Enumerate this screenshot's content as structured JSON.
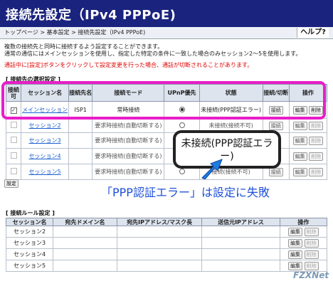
{
  "header": {
    "title": "接続先設定（IPv4 PPPoE)",
    "breadcrumb": "トップページ > 基本設定 > 接続先設定（IPv4 PPPoE)",
    "help": "ヘルプ?"
  },
  "description": {
    "line1": "複数の接続先と同時に接続するよう設定することができます。",
    "line2": "通常の通信にはメインセッションを使用し、指定した特定の条件に一致した場合のみセッション2〜5を使用します。",
    "warning": "通話中に[設定]ボタンをクリックして設定変更を行った場合、通話が切断されることがあります。"
  },
  "session_table": {
    "section_title": "[ 接続先の選択設定 ]",
    "headers": [
      "接続可",
      "セッション名",
      "接続先名",
      "接続モード",
      "UPnP優先",
      "状態",
      "接続/切断",
      "操作"
    ],
    "rows": [
      {
        "checked": true,
        "name": "メインセッション",
        "dest": "ISP1",
        "mode": "常時接続",
        "upnp": true,
        "status": "未接続(PPP認証エラー)",
        "connect": "接続",
        "edit": "編集",
        "delete": "削除"
      },
      {
        "checked": false,
        "name": "セッション2",
        "dest": "",
        "mode": "要求時接続(自動切断する)",
        "upnp": false,
        "status": "未接続(接続不可)",
        "connect": "接続",
        "edit": "編集",
        "delete": "削除"
      },
      {
        "checked": false,
        "name": "セッション3",
        "dest": "",
        "mode": "要求時接続(自動切断する)",
        "upnp": false,
        "status": "",
        "connect": "",
        "edit": "編集",
        "delete": "削除"
      },
      {
        "checked": false,
        "name": "セッション4",
        "dest": "",
        "mode": "要求時接続(自動切断する)",
        "upnp": false,
        "status": "",
        "connect": "",
        "edit": "編集",
        "delete": "削除"
      },
      {
        "checked": false,
        "name": "セッション5",
        "dest": "",
        "mode": "要求時接続(自動切断する)",
        "upnp": false,
        "status": "接続(接続不可)",
        "connect": "接続",
        "edit": "編集",
        "delete": "削除"
      }
    ],
    "set_button": "設定"
  },
  "rule_table": {
    "section_title": "[ 接続ルール設定 ]",
    "headers": [
      "セッション名",
      "宛先ドメイン名",
      "宛先IPアドレス/マスク長",
      "送信元IPアドレス",
      "操作"
    ],
    "rows": [
      {
        "name": "セッション2",
        "edit": "編集",
        "delete": "削除"
      },
      {
        "name": "セッション3",
        "edit": "編集",
        "delete": "削除"
      },
      {
        "name": "セッション4",
        "edit": "編集",
        "delete": "削除"
      },
      {
        "name": "セッション5",
        "edit": "編集",
        "delete": "削除"
      }
    ]
  },
  "annotation": {
    "callout": "未接続(PPP認証エラー)",
    "caption": "「PPP認証エラー」は設定に失敗",
    "logo": "FZXNet",
    "colors": {
      "highlight": "#e81ec8",
      "caption": "#1e50d8"
    }
  }
}
